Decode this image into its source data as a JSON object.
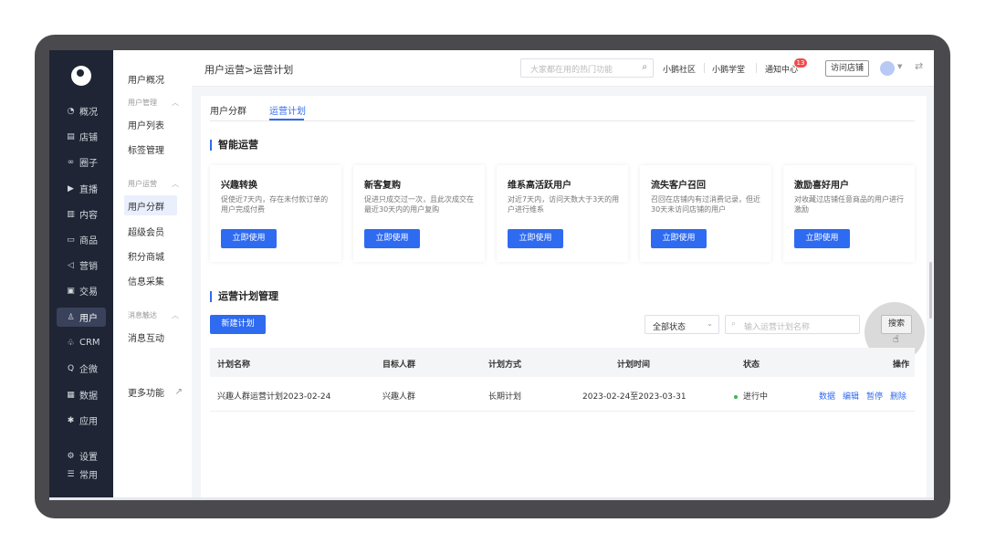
{
  "nav": {
    "items": [
      {
        "icon": "◔",
        "label": "概况"
      },
      {
        "icon": "▤",
        "label": "店铺"
      },
      {
        "icon": "∞",
        "label": "圈子"
      },
      {
        "icon": "▶",
        "label": "直播"
      },
      {
        "icon": "▥",
        "label": "内容"
      },
      {
        "icon": "▭",
        "label": "商品"
      },
      {
        "icon": "◁",
        "label": "营销"
      },
      {
        "icon": "▣",
        "label": "交易"
      },
      {
        "icon": "♙",
        "label": "用户"
      },
      {
        "icon": "♧",
        "label": "CRM"
      },
      {
        "icon": "Q",
        "label": "企微"
      },
      {
        "icon": "▦",
        "label": "数据"
      },
      {
        "icon": "✱",
        "label": "应用"
      },
      {
        "icon": "⚙",
        "label": "设置"
      },
      {
        "icon": "☰",
        "label": "常用"
      }
    ],
    "active_index": 8
  },
  "sub": {
    "overview": "用户概况",
    "group1": "用户管理",
    "group1_items": [
      "用户列表",
      "标签管理"
    ],
    "group2": "用户运营",
    "group2_items": [
      "用户分群",
      "超级会员",
      "积分商城",
      "信息采集"
    ],
    "group3": "消息触达",
    "group3_items": [
      "消息互动"
    ],
    "more": "更多功能",
    "collapse_glyph": "︿",
    "more_glyph": "↗"
  },
  "header": {
    "breadcrumb": "用户运营>运营计划",
    "search_placeholder": "大家都在用的热门功能",
    "links": [
      "小鹅社区",
      "小鹅学堂",
      "通知中心"
    ],
    "notification_count": "13",
    "visit_store": "访问店铺"
  },
  "tabs": [
    "用户分群",
    "运营计划"
  ],
  "active_tab": 1,
  "smart": {
    "title": "智能运营",
    "cards": [
      {
        "title": "兴趣转换",
        "desc": "促使近7天内，存在未付款订单的用户完成付费",
        "button": "立即使用"
      },
      {
        "title": "新客复购",
        "desc": "促进只成交过一次，且此次成交在最近30天内的用户复购",
        "button": "立即使用"
      },
      {
        "title": "维系高活跃用户",
        "desc": "对近7天内，访问天数大于3天的用户进行维系",
        "button": "立即使用"
      },
      {
        "title": "流失客户召回",
        "desc": "召回在店铺内有过消费记录，但近30天未访问店铺的用户",
        "button": "立即使用"
      },
      {
        "title": "激励喜好用户",
        "desc": "对收藏过店铺任意商品的用户进行激励",
        "button": "立即使用"
      }
    ]
  },
  "plans": {
    "title": "运营计划管理",
    "new_button": "新建计划",
    "status_filter": "全部状态",
    "search_placeholder": "输入运营计划名称",
    "search_button": "搜索",
    "columns": [
      "计划名称",
      "目标人群",
      "计划方式",
      "计划时间",
      "状态",
      "操作"
    ],
    "rows": [
      {
        "name": "兴趣人群运营计划2023-02-24",
        "audience": "兴趣人群",
        "mode": "长期计划",
        "time": "2023-02-24至2023-03-31",
        "status": "进行中",
        "status_color": "#3ab54a",
        "ops": [
          "数据",
          "编辑",
          "暂停",
          "删除"
        ]
      }
    ]
  }
}
